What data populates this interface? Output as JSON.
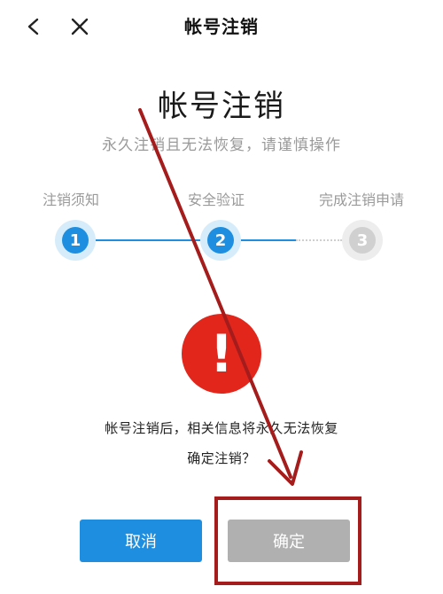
{
  "nav": {
    "title": "帐号注销",
    "back_icon": "chevron-left-icon",
    "close_icon": "close-icon"
  },
  "header": {
    "title": "帐号注销",
    "subtitle": "永久注销且无法恢复，请谨慎操作"
  },
  "steps": [
    {
      "number": "1",
      "label": "注销须知",
      "state": "active"
    },
    {
      "number": "2",
      "label": "安全验证",
      "state": "active"
    },
    {
      "number": "3",
      "label": "完成注销申请",
      "state": "inactive"
    }
  ],
  "warning": {
    "icon": "exclamation-icon",
    "mark": "!",
    "message_line1": "帐号注销后，相关信息将永久无法恢复",
    "message_line2": "确定注销？"
  },
  "actions": {
    "cancel_label": "取消",
    "confirm_label": "确定"
  },
  "colors": {
    "accent": "#1e8fe0",
    "warning": "#e2261c",
    "disabled": "#b0b0b0",
    "annotation": "#a51c1c"
  }
}
